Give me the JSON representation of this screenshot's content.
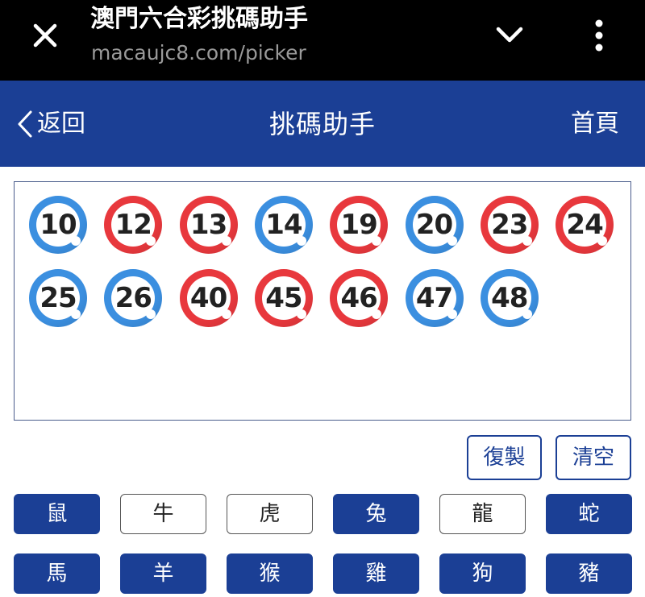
{
  "browser": {
    "site_title": "澳門六合彩挑碼助手",
    "url": "macaujc8.com/picker"
  },
  "header": {
    "back_label": "返回",
    "title": "挑碼助手",
    "home_label": "首頁"
  },
  "colors": {
    "brand": "#1b3f95",
    "red_ball": "#e8383d",
    "blue_ball": "#3b8fe0"
  },
  "balls": [
    {
      "number": "10",
      "color": "blue"
    },
    {
      "number": "12",
      "color": "red"
    },
    {
      "number": "13",
      "color": "red"
    },
    {
      "number": "14",
      "color": "blue"
    },
    {
      "number": "19",
      "color": "red"
    },
    {
      "number": "20",
      "color": "blue"
    },
    {
      "number": "23",
      "color": "red"
    },
    {
      "number": "24",
      "color": "red"
    },
    {
      "number": "25",
      "color": "blue"
    },
    {
      "number": "26",
      "color": "blue"
    },
    {
      "number": "40",
      "color": "red"
    },
    {
      "number": "45",
      "color": "red"
    },
    {
      "number": "46",
      "color": "red"
    },
    {
      "number": "47",
      "color": "blue"
    },
    {
      "number": "48",
      "color": "blue"
    }
  ],
  "actions": {
    "copy_label": "復製",
    "clear_label": "清空"
  },
  "zodiacs": [
    {
      "label": "鼠",
      "selected": true
    },
    {
      "label": "牛",
      "selected": false
    },
    {
      "label": "虎",
      "selected": false
    },
    {
      "label": "兔",
      "selected": true
    },
    {
      "label": "龍",
      "selected": false
    },
    {
      "label": "蛇",
      "selected": true
    },
    {
      "label": "馬",
      "selected": true
    },
    {
      "label": "羊",
      "selected": true
    },
    {
      "label": "猴",
      "selected": true
    },
    {
      "label": "雞",
      "selected": true
    },
    {
      "label": "狗",
      "selected": true
    },
    {
      "label": "豬",
      "selected": true
    }
  ]
}
